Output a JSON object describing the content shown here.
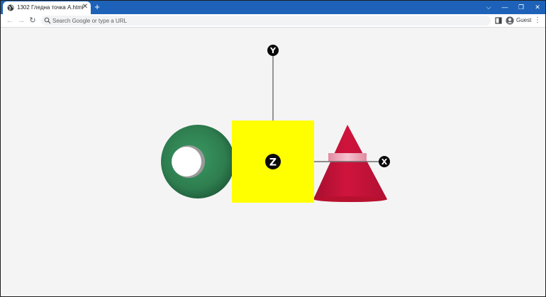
{
  "browser": {
    "tab_title": "1302 Гледна точка A.html",
    "new_tab_label": "+",
    "controls": {
      "tab_search": "⌵",
      "minimize": "—",
      "restore": "❐",
      "close": "✕"
    }
  },
  "toolbar": {
    "back": "←",
    "forward": "→",
    "reload": "↻",
    "omnibox_placeholder": "Search Google or type a URL",
    "profile_label": "Guest",
    "menu": "⋮"
  },
  "scene": {
    "axes": {
      "y_label": "Y",
      "z_label": "Z",
      "x_label": "X"
    },
    "colors": {
      "sphere": "#2e7d4f",
      "cube": "#ffff00",
      "cone": "#d0143c",
      "ring": "#f2a7b8",
      "axis_badge": "#0a0a0a"
    }
  }
}
